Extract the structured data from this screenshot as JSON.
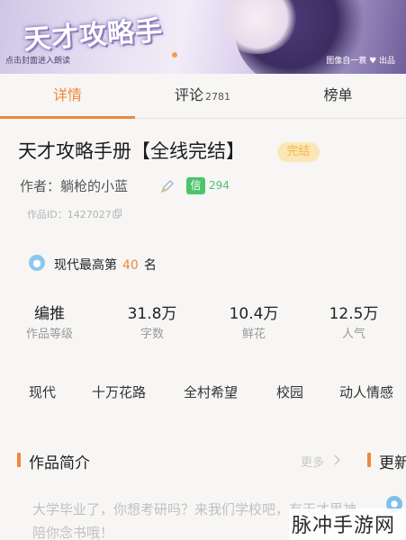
{
  "banner": {
    "logo_text": "天才攻略手",
    "hint": "点击封面进入朗读",
    "credit": "图像自一蓑 ♥ 出品"
  },
  "tabs": [
    {
      "label": "详情",
      "active": true
    },
    {
      "label": "评论",
      "count": "2781"
    },
    {
      "label": "榜单"
    }
  ],
  "book": {
    "title": "天才攻略手册【全线完结】",
    "status_badge": "完结",
    "author": "作者：躺枪的小蓝",
    "xin_label": "信",
    "xin_count": "294",
    "work_id": "作品ID：1427027"
  },
  "rank": {
    "prefix": "现代最高第",
    "number": "40",
    "suffix": "名"
  },
  "stats": [
    {
      "value": "编推",
      "label": "作品等级"
    },
    {
      "value": "31.8万",
      "label": "字数"
    },
    {
      "value": "10.4万",
      "label": "鲜花"
    },
    {
      "value": "12.5万",
      "label": "人气"
    }
  ],
  "tags": [
    "现代",
    "十万花路",
    "全村希望",
    "校园",
    "动人情感"
  ],
  "intro": {
    "title": "作品简介",
    "more": "更多",
    "next_section_title": "更新",
    "text": "大学毕业了，你想考研吗？来我们学校吧，有天才男神陪你念书哦！"
  },
  "watermark": "脉冲手游网",
  "colors": {
    "accent": "#f0883a",
    "green": "#4cc46a",
    "badge_bg": "#fbe7b6"
  }
}
